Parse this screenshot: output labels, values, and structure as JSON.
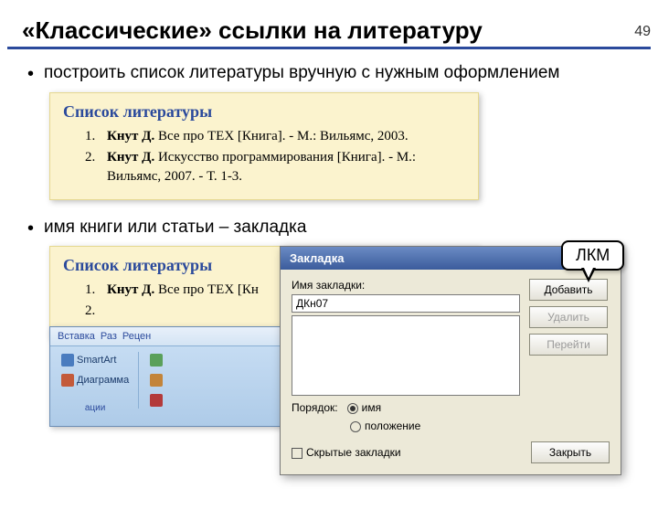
{
  "page_number": "49",
  "title": "«Классические» ссылки на литературу",
  "bullets": {
    "b1": "построить список литературы вручную с нужным оформлением",
    "b2": "имя книги или статьи – закладка"
  },
  "biblio": {
    "heading": "Список литературы",
    "items": [
      {
        "num": "1.",
        "author": "Кнут Д.",
        "rest": " Все про TEX [Книга]. - М.: Вильямс, 2003."
      },
      {
        "num": "2.",
        "author": "Кнут Д.",
        "rest": " Искусство программирования [Книга]. - М.: Вильямс, 2007. - Т. 1-3."
      }
    ]
  },
  "biblio2": {
    "heading": "Список литературы",
    "items": [
      {
        "num": "1.",
        "author": "Кнут Д.",
        "rest": " Все про TEX [Кн"
      },
      {
        "num": "2.",
        "author": "",
        "rest": ""
      }
    ]
  },
  "ribbon": {
    "tabs": [
      "Вставка",
      "Раз",
      "Рецен"
    ],
    "smartart": "SmartArt",
    "diagram": "Диаграмма",
    "group": "ации"
  },
  "dialog": {
    "title": "Закладка",
    "name_label": "Имя закладки:",
    "name_value": "ДКн07",
    "order_label": "Порядок:",
    "radio_name": "имя",
    "radio_pos": "положение",
    "hidden_check": "Скрытые закладки",
    "btn_add": "Добавить",
    "btn_del": "Удалить",
    "btn_go": "Перейти",
    "btn_close": "Закрыть"
  },
  "callout": "ЛКМ"
}
